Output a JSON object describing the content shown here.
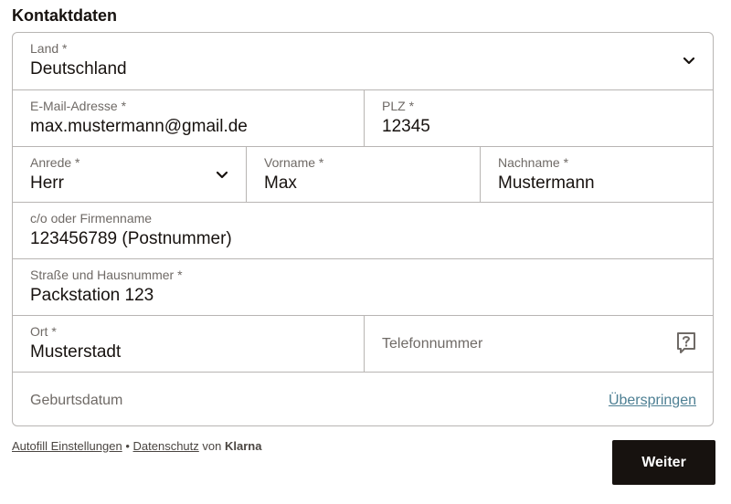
{
  "title": "Kontaktdaten",
  "fields": {
    "land": {
      "label": "Land *",
      "value": "Deutschland"
    },
    "email": {
      "label": "E-Mail-Adresse *",
      "value": "max.mustermann@gmail.de"
    },
    "plz": {
      "label": "PLZ *",
      "value": "12345"
    },
    "anrede": {
      "label": "Anrede *",
      "value": "Herr"
    },
    "vorname": {
      "label": "Vorname *",
      "value": "Max"
    },
    "nachname": {
      "label": "Nachname *",
      "value": "Mustermann"
    },
    "co": {
      "label": "c/o oder Firmenname",
      "value": "123456789 (Postnummer)"
    },
    "strasse": {
      "label": "Straße und Hausnummer *",
      "value": "Packstation 123"
    },
    "ort": {
      "label": "Ort *",
      "value": "Musterstadt"
    },
    "telefon": {
      "placeholder": "Telefonnummer"
    },
    "geburtsdatum": {
      "placeholder": "Geburtsdatum",
      "skip_label": "Überspringen"
    }
  },
  "footer": {
    "autofill_label": "Autofill Einstellungen",
    "separator": "•",
    "privacy_label": "Datenschutz",
    "by_text": "von",
    "brand": "Klarna"
  },
  "submit_label": "Weiter",
  "colors": {
    "accent": "#17120f",
    "border": "#b8b5b3",
    "link": "#4d7f93",
    "muted": "#6f6a66"
  },
  "icons": {
    "dropdown": "chevron-down-icon",
    "help": "help-icon"
  }
}
